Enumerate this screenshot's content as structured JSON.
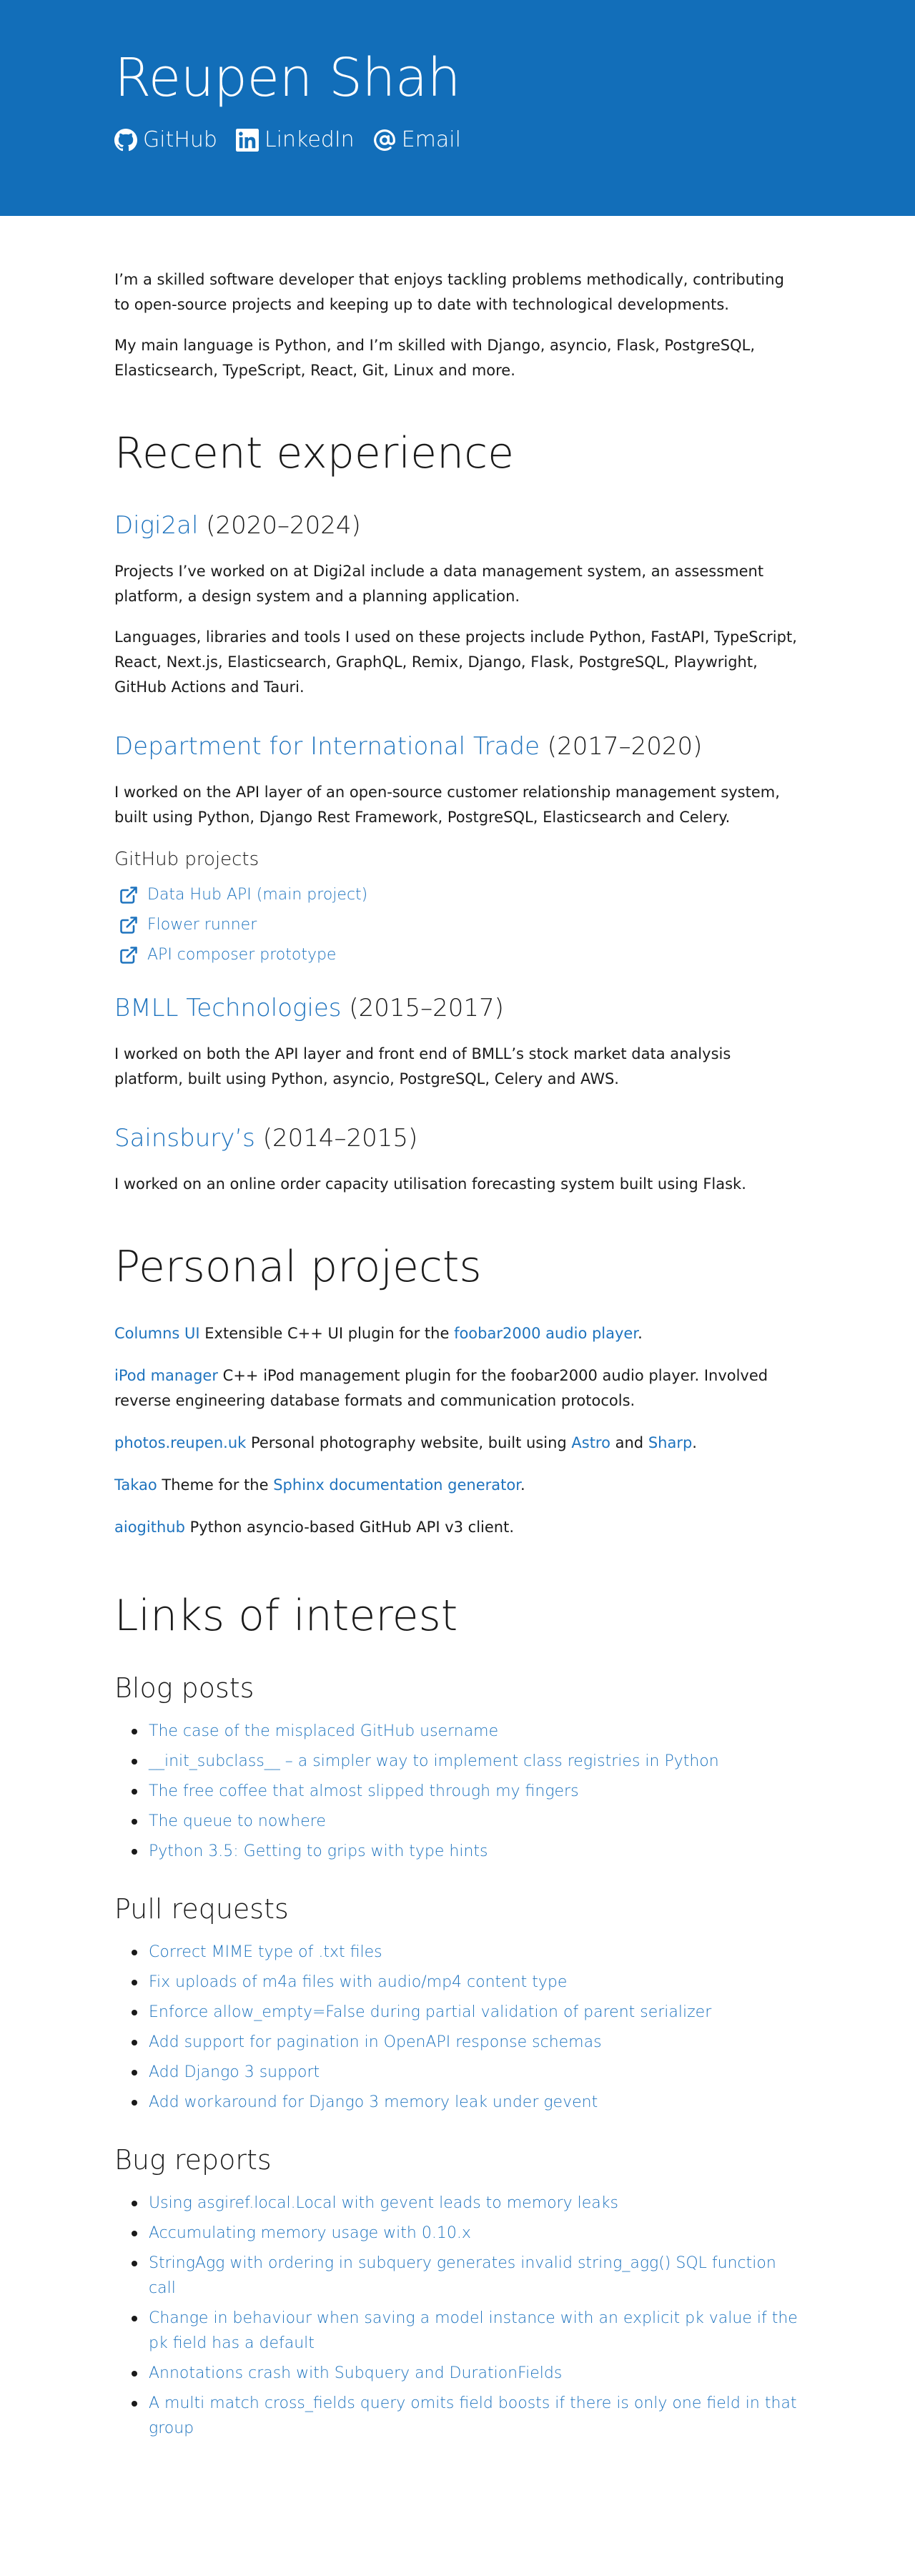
{
  "header": {
    "name": "Reupen Shah",
    "links": [
      {
        "icon": "github-icon",
        "label": "GitHub"
      },
      {
        "icon": "linkedin-icon",
        "label": "LinkedIn"
      },
      {
        "icon": "at-sign-icon",
        "label": "Email"
      }
    ]
  },
  "intro": [
    "I’m a skilled software developer that enjoys tackling problems methodically, contributing to open-source projects and keeping up to date with technological developments.",
    "My main language is Python, and I’m skilled with Django, asyncio, Flask, PostgreSQL, Elasticsearch, TypeScript, React, Git, Linux and more."
  ],
  "experience": {
    "title": "Recent experience",
    "jobs": [
      {
        "company": "Digi2al",
        "years": " (2020–2024)",
        "paragraphs": [
          "Projects I’ve worked on at Digi2al include a data management system, an assessment platform, a design system and a planning application.",
          "Languages, libraries and tools I used on these projects include Python, FastAPI, TypeScript, React, Next.js, Elasticsearch, GraphQL, Remix, Django, Flask, PostgreSQL, Playwright, GitHub Actions and Tauri."
        ]
      },
      {
        "company": "Department for International Trade",
        "years": " (2017–2020)",
        "paragraph": "I worked on the API layer of an open-source customer relationship management system, built using Python, Django Rest Framework, PostgreSQL, Elasticsearch and Celery.",
        "projects_title": "GitHub projects",
        "projects": [
          "Data Hub API (main project)",
          "Flower runner",
          "API composer prototype"
        ]
      },
      {
        "company": "BMLL Technologies",
        "years": " (2015–2017)",
        "paragraph": "I worked on both the API layer and front end of BMLL’s stock market data analysis platform, built using Python, asyncio, PostgreSQL, Celery and AWS."
      },
      {
        "company": "Sainsbury’s",
        "years": " (2014–2015)",
        "paragraph": "I worked on an online order capacity utilisation forecasting system built using Flask."
      }
    ]
  },
  "projects": {
    "title": "Personal projects",
    "items": [
      {
        "name": "Columns UI",
        "pre": " Extensible C++ UI plugin for the ",
        "link": "foobar2000 audio player",
        "post": "."
      },
      {
        "name": "iPod manager",
        "text": " C++ iPod management plugin for the foobar2000 audio player. Involved reverse engineering database formats and communication protocols."
      },
      {
        "name": "photos.reupen.uk",
        "pre": " Personal photography website, built using ",
        "link1": "Astro",
        "mid": " and ",
        "link2": "Sharp",
        "post": "."
      },
      {
        "name": "Takao",
        "pre": " Theme for the ",
        "link": "Sphinx documentation generator",
        "post": "."
      },
      {
        "name": "aiogithub",
        "text": " Python asyncio-based GitHub API v3 client."
      }
    ]
  },
  "links": {
    "title": "Links of interest",
    "blog_title": "Blog posts",
    "blog": [
      "The case of the misplaced GitHub username",
      "__init_subclass__ – a simpler way to implement class registries in Python",
      "The free coffee that almost slipped through my fingers",
      "The queue to nowhere",
      "Python 3.5: Getting to grips with type hints"
    ],
    "pr_title": "Pull requests",
    "prs": [
      "Correct MIME type of .txt files",
      "Fix uploads of m4a files with audio/mp4 content type",
      "Enforce allow_empty=False during partial validation of parent serializer",
      "Add support for pagination in OpenAPI response schemas",
      "Add Django 3 support",
      "Add workaround for Django 3 memory leak under gevent"
    ],
    "bug_title": "Bug reports",
    "bugs": [
      "Using asgiref.local.Local with gevent leads to memory leaks",
      "Accumulating memory usage with 0.10.x",
      "StringAgg with ordering in subquery generates invalid string_agg() SQL function call",
      "Change in behaviour when saving a model instance with an explicit pk value if the pk field has a default",
      "Annotations crash with Subquery and DurationFields",
      "A multi match cross_fields query omits field boosts if there is only one field in that group"
    ]
  },
  "colors": {
    "header_bg": "#126eb9",
    "link": "#1e73be",
    "text": "#1a1a1a"
  }
}
